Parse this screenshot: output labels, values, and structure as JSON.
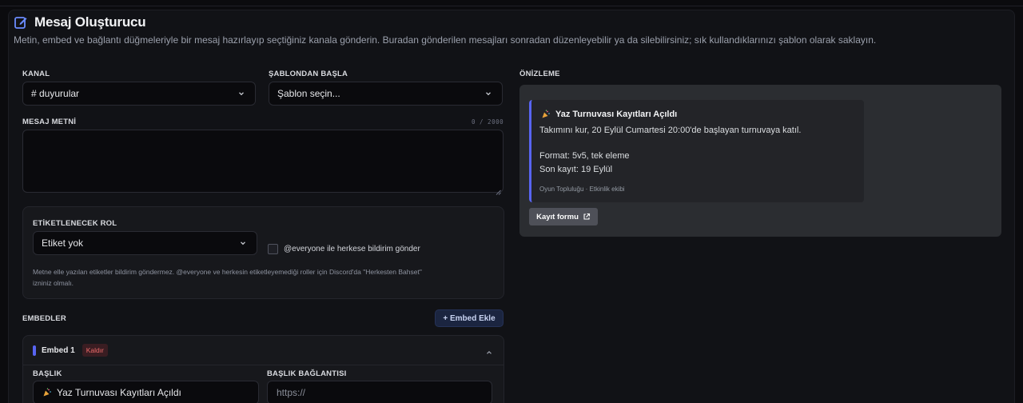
{
  "header": {
    "title": "Mesaj Oluşturucu",
    "subtitle": "Metin, embed ve bağlantı düğmeleriyle bir mesaj hazırlayıp seçtiğiniz kanala gönderin. Buradan gönderilen mesajları sonradan düzenleyebilir ya da silebilirsiniz; sık kullandıklarınızı şablon olarak saklayın."
  },
  "form": {
    "channel_label": "KANAL",
    "channel_value": "# duyurular",
    "template_label": "ŞABLONDAN BAŞLA",
    "template_value": "Şablon seçin...",
    "message_label": "MESAJ METNİ",
    "message_counter": "0 / 2000",
    "message_value": ""
  },
  "role": {
    "label": "ETİKETLENECEK ROL",
    "value": "Etiket yok",
    "everyone_label": "@everyone ile herkese bildirim gönder",
    "everyone_checked": false,
    "help_line1": "Metne elle yazılan etiketler bildirim göndermez. @everyone ve herkesin etiketleyemediği roller için Discord'da \"Herkesten Bahset\"",
    "help_line2": "izniniz olmalı."
  },
  "embeds": {
    "label": "EMBEDLER",
    "add_button": "+ Embed Ekle",
    "items": [
      {
        "name": "Embed 1",
        "remove_label": "Kaldır",
        "accent_color": "#5865f2",
        "title_label": "BAŞLIK",
        "title_value": "Yaz Turnuvası Kayıtları Açıldı",
        "title_link_label": "BAŞLIK BAĞLANTISI",
        "title_link_placeholder": "https://"
      }
    ]
  },
  "preview": {
    "label": "ÖNİZLEME",
    "embed_title": "Yaz Turnuvası Kayıtları Açıldı",
    "line1": "Takımını kur, 20 Eylül Cumartesi 20:00'de başlayan turnuvaya katıl.",
    "line2": "Format: 5v5, tek eleme",
    "line3": "Son kayıt: 19 Eylül",
    "footer": "Oyun Topluluğu · Etkinlik ekibi",
    "link_button": "Kayıt formu",
    "accent_color": "#5865f2"
  }
}
